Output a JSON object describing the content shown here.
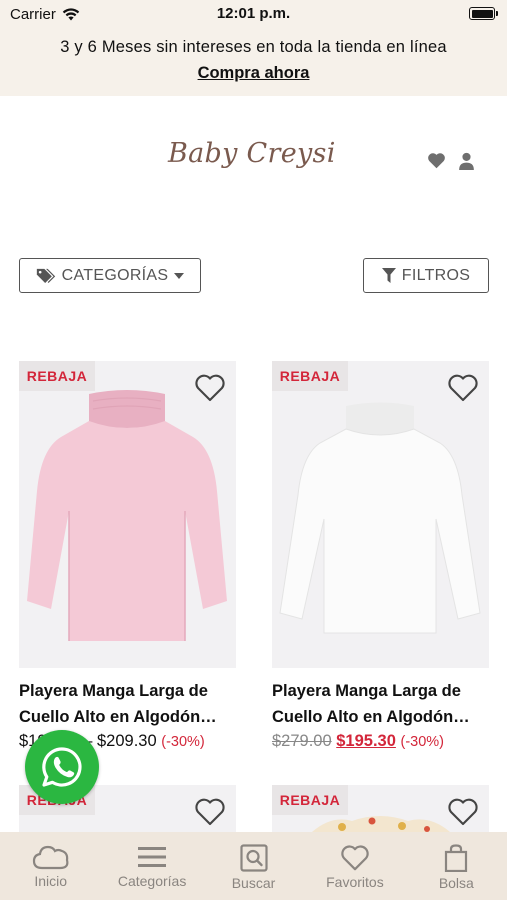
{
  "status_bar": {
    "carrier": "Carrier",
    "time": "12:01 p.m."
  },
  "promo": {
    "text": "3 y 6 Meses sin intereses en toda la tienda en línea",
    "link": "Compra ahora"
  },
  "header": {
    "logo": "Baby Creysi",
    "icons": [
      "heart-icon",
      "user-icon"
    ]
  },
  "filters": {
    "categories_label": "CATEGORÍAS",
    "filters_label": "FILTROS"
  },
  "products": [
    {
      "badge": "REBAJA",
      "title_line1": "Playera Manga Larga de",
      "title_line2": "Cuello Alto en Algodón…",
      "price": "$195.30 – $209.30",
      "discount": "(-30%)",
      "color": "#f4c9d6"
    },
    {
      "badge": "REBAJA",
      "title_line1": "Playera Manga Larga de",
      "title_line2": "Cuello Alto en Algodón…",
      "price_old": "$279.00",
      "price_sale": "$195.30",
      "discount": "(-30%)",
      "color": "#fbfbfb"
    },
    {
      "badge": "REBAJA"
    },
    {
      "badge": "REBAJA"
    }
  ],
  "tabbar": {
    "items": [
      {
        "label": "Inicio",
        "icon": "cloud-icon"
      },
      {
        "label": "Categorías",
        "icon": "menu-icon"
      },
      {
        "label": "Buscar",
        "icon": "search-icon"
      },
      {
        "label": "Favoritos",
        "icon": "heart-icon"
      },
      {
        "label": "Bolsa",
        "icon": "bag-icon"
      }
    ]
  },
  "colors": {
    "accent_red": "#d3263a",
    "promo_bg": "#f6f1ea",
    "tabbar_bg": "#efe7dd",
    "whatsapp": "#2bb741",
    "logo": "#7a5a4e"
  }
}
